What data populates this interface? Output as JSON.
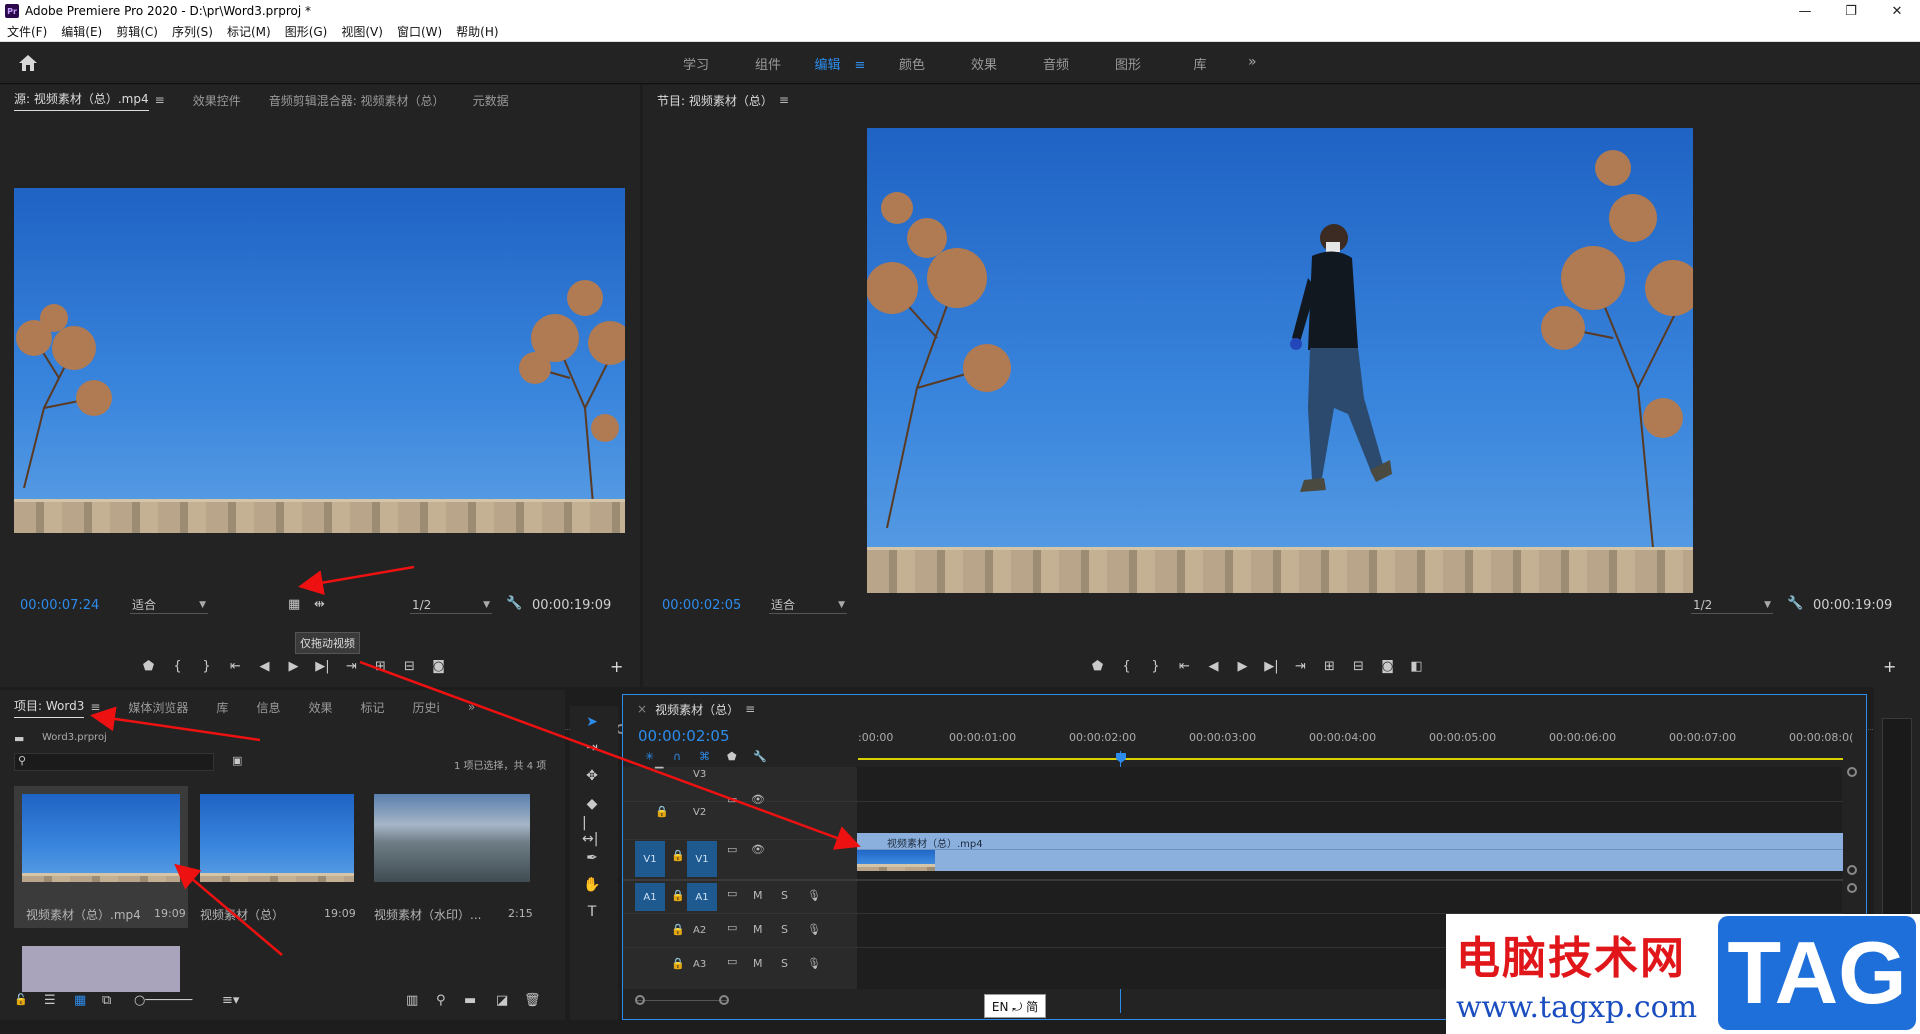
{
  "window": {
    "title": "Adobe Premiere Pro 2020 - D:\\pr\\Word3.prproj *",
    "minimize": "—",
    "restore": "❐",
    "close": "✕"
  },
  "menu": [
    "文件(F)",
    "编辑(E)",
    "剪辑(C)",
    "序列(S)",
    "标记(M)",
    "图形(G)",
    "视图(V)",
    "窗口(W)",
    "帮助(H)"
  ],
  "workspaces": {
    "tabs": [
      "学习",
      "组件",
      "编辑",
      "颜色",
      "效果",
      "音频",
      "图形",
      "库"
    ],
    "active": "编辑",
    "more": "»"
  },
  "source_monitor": {
    "tabs": [
      "源: 视频素材（总）.mp4",
      "效果控件",
      "音频剪辑混合器: 视频素材（总）",
      "元数据"
    ],
    "timecode": "00:00:07:24",
    "fit": "适合",
    "resolution": "1/2",
    "duration": "00:00:19:09",
    "tooltip": "仅拖动视频"
  },
  "program_monitor": {
    "title": "节目: 视频素材（总）",
    "timecode": "00:00:02:05",
    "fit": "适合",
    "resolution": "1/2",
    "duration": "00:00:19:09"
  },
  "project": {
    "tabs": [
      "项目: Word3",
      "媒体浏览器",
      "库",
      "信息",
      "效果",
      "标记",
      "历史i"
    ],
    "file": "Word3.prproj",
    "selection": "1 项已选择，共 4 项",
    "items": [
      {
        "name": "视频素材（总）.mp4",
        "duration": "19:09"
      },
      {
        "name": "视频素材（总）",
        "duration": "19:09"
      },
      {
        "name": "视频素材（水印）...",
        "duration": "2:15"
      }
    ]
  },
  "timeline": {
    "title": "视频素材（总）",
    "timecode": "00:00:02:05",
    "ticks": [
      ":00:00",
      "00:00:01:00",
      "00:00:02:00",
      "00:00:03:00",
      "00:00:04:00",
      "00:00:05:00",
      "00:00:06:00",
      "00:00:07:00",
      "00:00:08:0("
    ],
    "tracks": [
      "V3",
      "V2",
      "V1",
      "A1",
      "A2",
      "A3"
    ],
    "clip_name": "视频素材（总）.mp4",
    "mute": "M",
    "solo": "S"
  },
  "ime": "EN ⤾ 简",
  "watermark": {
    "text": "电脑技术网",
    "url": "www.tagxp.com",
    "logo": "TAG"
  },
  "colors": {
    "accent": "#2d8ceb",
    "panel": "#232323",
    "clip": "#8bb0dd",
    "arrow": "#e11111"
  }
}
